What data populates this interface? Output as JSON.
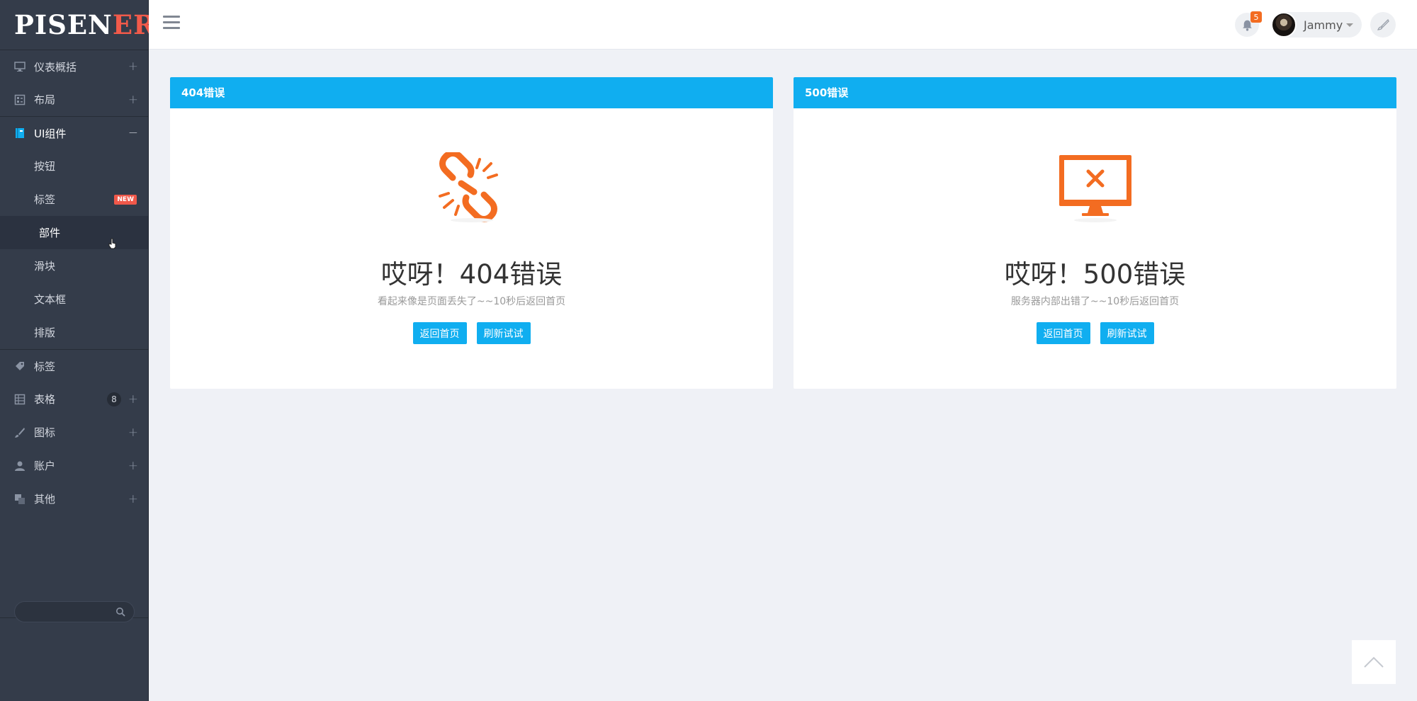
{
  "logo": {
    "main": "PISEN",
    "accent": "ER"
  },
  "sidebar": {
    "items": [
      {
        "label": "仪表概括",
        "icon": "monitor-icon",
        "expand": "+"
      },
      {
        "label": "布局",
        "icon": "layout-icon",
        "expand": "+"
      },
      {
        "label": "UI组件",
        "icon": "book-icon",
        "expand": "−"
      },
      {
        "label": "标签",
        "icon": "tag-icon"
      },
      {
        "label": "表格",
        "icon": "table-icon",
        "badge": "8",
        "expand": "+"
      },
      {
        "label": "图标",
        "icon": "brush-icon",
        "expand": "+"
      },
      {
        "label": "账户",
        "icon": "user-icon",
        "expand": "+"
      },
      {
        "label": "其他",
        "icon": "squares-icon",
        "expand": "+"
      }
    ],
    "sub_items": [
      {
        "label": "按钮"
      },
      {
        "label": "标签",
        "badge": "NEW"
      },
      {
        "label": "部件"
      },
      {
        "label": "滑块"
      },
      {
        "label": "文本框"
      },
      {
        "label": "排版"
      }
    ],
    "search": {
      "placeholder": "",
      "value": ""
    }
  },
  "header": {
    "notifications": "5",
    "user_name": "Jammy"
  },
  "panels": [
    {
      "title": "404错误",
      "heading": "哎呀！404错误",
      "message": "看起来像是页面丢失了~~10秒后返回首页",
      "btn_home": "返回首页",
      "btn_refresh": "刷新试试",
      "icon": "broken-link-icon"
    },
    {
      "title": "500错误",
      "heading": "哎呀！500错误",
      "message": "服务器内部出错了~~10秒后返回首页",
      "btn_home": "返回首页",
      "btn_refresh": "刷新试试",
      "icon": "monitor-error-icon"
    }
  ],
  "colors": {
    "accent": "#10aef0",
    "error_icon": "#f36c21",
    "sidebar": "#343c4a",
    "new_badge": "#f0584a"
  }
}
